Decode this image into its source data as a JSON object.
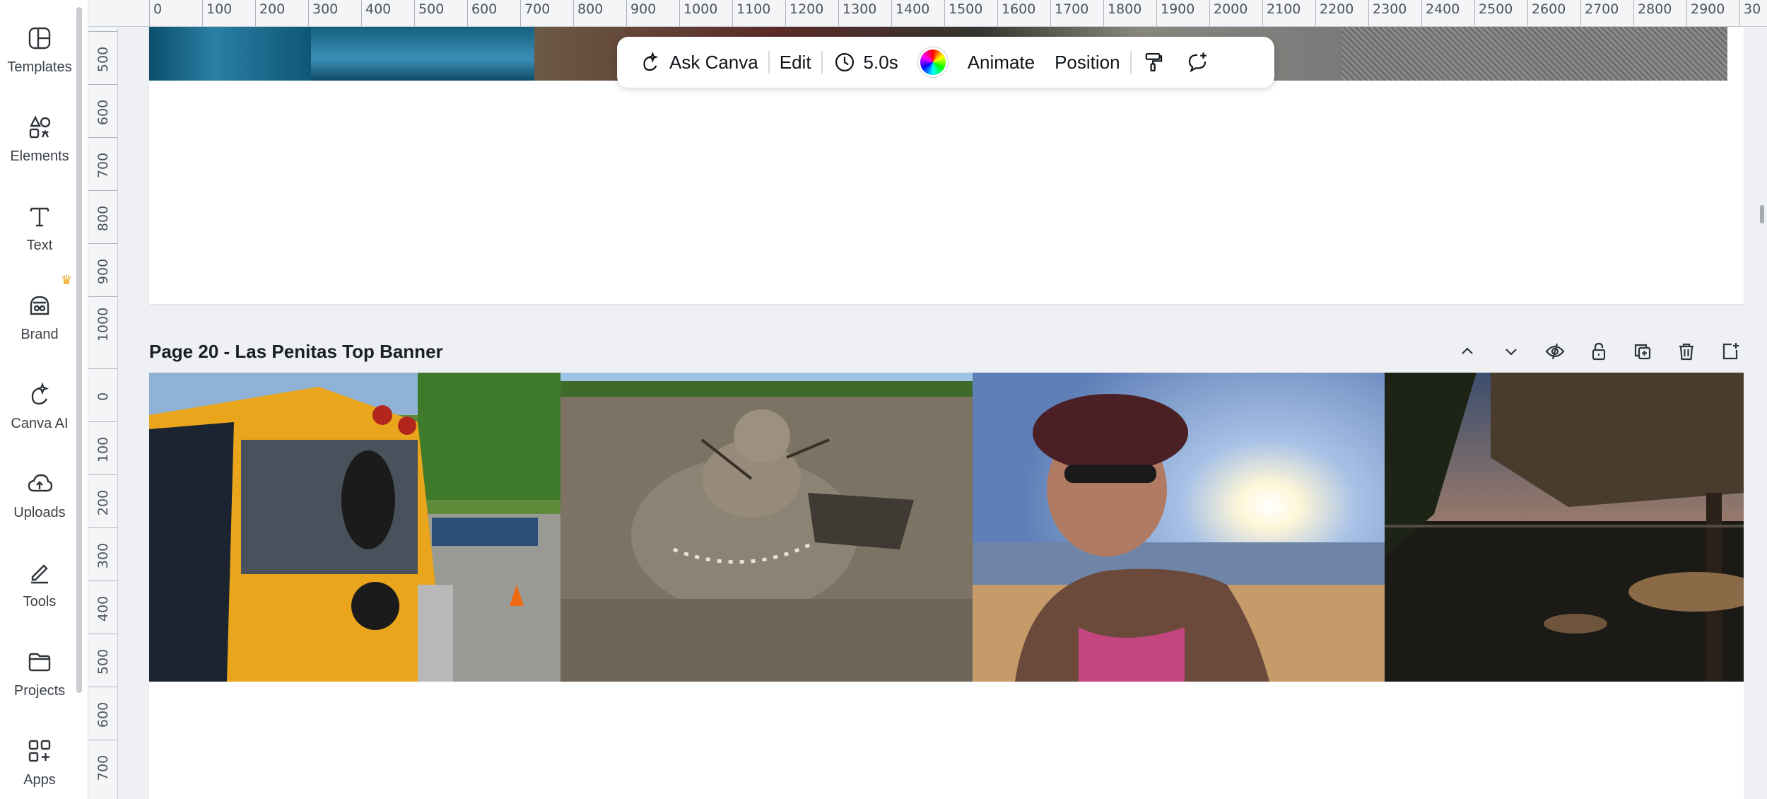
{
  "sidebar": {
    "items": [
      {
        "label": "Templates",
        "icon": "templates-icon"
      },
      {
        "label": "Elements",
        "icon": "elements-icon"
      },
      {
        "label": "Text",
        "icon": "text-icon"
      },
      {
        "label": "Brand",
        "icon": "brand-icon"
      },
      {
        "label": "Canva AI",
        "icon": "canva-ai-icon"
      },
      {
        "label": "Uploads",
        "icon": "uploads-icon"
      },
      {
        "label": "Tools",
        "icon": "tools-icon"
      },
      {
        "label": "Projects",
        "icon": "projects-icon"
      },
      {
        "label": "Apps",
        "icon": "apps-icon"
      }
    ],
    "brand_badge": "crown-icon"
  },
  "ruler": {
    "top_labels": [
      "0",
      "100",
      "200",
      "300",
      "400",
      "500",
      "600",
      "700",
      "800",
      "900",
      "1000",
      "1100",
      "1200",
      "1300",
      "1400",
      "1500",
      "1600",
      "1700",
      "1800",
      "1900",
      "2000",
      "2100",
      "2200",
      "2300",
      "2400",
      "2500",
      "2600",
      "2700",
      "2800",
      "2900",
      "30"
    ],
    "left_labels_page19": [
      "500",
      "600",
      "700",
      "800",
      "900",
      "1000"
    ],
    "left_labels_page20": [
      "0",
      "100",
      "200",
      "300",
      "400",
      "500",
      "600",
      "700"
    ]
  },
  "toolbar": {
    "ask_canva": "Ask Canva",
    "edit": "Edit",
    "duration": "5.0s",
    "animate": "Animate",
    "position": "Position"
  },
  "page20": {
    "title": "Page 20 - Las Penitas Top Banner",
    "actions": [
      "move-up-icon",
      "move-down-icon",
      "hide-page-icon",
      "lock-icon",
      "duplicate-page-icon",
      "delete-page-icon",
      "add-page-icon"
    ]
  },
  "colors": {
    "accent": "#8b3dff",
    "canvas_bg": "#eef0f4"
  }
}
